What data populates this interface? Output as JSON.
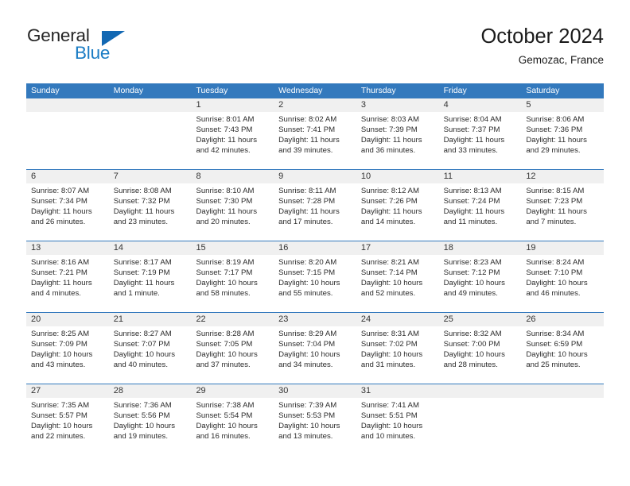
{
  "brand": {
    "name_part1": "General",
    "name_part2": "Blue",
    "triangle_color": "#1268B3",
    "blue_color": "#1A7CC4"
  },
  "header": {
    "title": "October 2024",
    "subtitle": "Gemozac, France"
  },
  "theme": {
    "header_blue": "#3379BD",
    "date_band_gray": "#F0F0F0",
    "text_color": "#2b2b2b"
  },
  "calendar": {
    "day_names": [
      "Sunday",
      "Monday",
      "Tuesday",
      "Wednesday",
      "Thursday",
      "Friday",
      "Saturday"
    ],
    "weeks": [
      [
        {
          "date": "",
          "lines": []
        },
        {
          "date": "",
          "lines": []
        },
        {
          "date": "1",
          "lines": [
            "Sunrise: 8:01 AM",
            "Sunset: 7:43 PM",
            "Daylight: 11 hours",
            "and 42 minutes."
          ]
        },
        {
          "date": "2",
          "lines": [
            "Sunrise: 8:02 AM",
            "Sunset: 7:41 PM",
            "Daylight: 11 hours",
            "and 39 minutes."
          ]
        },
        {
          "date": "3",
          "lines": [
            "Sunrise: 8:03 AM",
            "Sunset: 7:39 PM",
            "Daylight: 11 hours",
            "and 36 minutes."
          ]
        },
        {
          "date": "4",
          "lines": [
            "Sunrise: 8:04 AM",
            "Sunset: 7:37 PM",
            "Daylight: 11 hours",
            "and 33 minutes."
          ]
        },
        {
          "date": "5",
          "lines": [
            "Sunrise: 8:06 AM",
            "Sunset: 7:36 PM",
            "Daylight: 11 hours",
            "and 29 minutes."
          ]
        }
      ],
      [
        {
          "date": "6",
          "lines": [
            "Sunrise: 8:07 AM",
            "Sunset: 7:34 PM",
            "Daylight: 11 hours",
            "and 26 minutes."
          ]
        },
        {
          "date": "7",
          "lines": [
            "Sunrise: 8:08 AM",
            "Sunset: 7:32 PM",
            "Daylight: 11 hours",
            "and 23 minutes."
          ]
        },
        {
          "date": "8",
          "lines": [
            "Sunrise: 8:10 AM",
            "Sunset: 7:30 PM",
            "Daylight: 11 hours",
            "and 20 minutes."
          ]
        },
        {
          "date": "9",
          "lines": [
            "Sunrise: 8:11 AM",
            "Sunset: 7:28 PM",
            "Daylight: 11 hours",
            "and 17 minutes."
          ]
        },
        {
          "date": "10",
          "lines": [
            "Sunrise: 8:12 AM",
            "Sunset: 7:26 PM",
            "Daylight: 11 hours",
            "and 14 minutes."
          ]
        },
        {
          "date": "11",
          "lines": [
            "Sunrise: 8:13 AM",
            "Sunset: 7:24 PM",
            "Daylight: 11 hours",
            "and 11 minutes."
          ]
        },
        {
          "date": "12",
          "lines": [
            "Sunrise: 8:15 AM",
            "Sunset: 7:23 PM",
            "Daylight: 11 hours",
            "and 7 minutes."
          ]
        }
      ],
      [
        {
          "date": "13",
          "lines": [
            "Sunrise: 8:16 AM",
            "Sunset: 7:21 PM",
            "Daylight: 11 hours",
            "and 4 minutes."
          ]
        },
        {
          "date": "14",
          "lines": [
            "Sunrise: 8:17 AM",
            "Sunset: 7:19 PM",
            "Daylight: 11 hours",
            "and 1 minute."
          ]
        },
        {
          "date": "15",
          "lines": [
            "Sunrise: 8:19 AM",
            "Sunset: 7:17 PM",
            "Daylight: 10 hours",
            "and 58 minutes."
          ]
        },
        {
          "date": "16",
          "lines": [
            "Sunrise: 8:20 AM",
            "Sunset: 7:15 PM",
            "Daylight: 10 hours",
            "and 55 minutes."
          ]
        },
        {
          "date": "17",
          "lines": [
            "Sunrise: 8:21 AM",
            "Sunset: 7:14 PM",
            "Daylight: 10 hours",
            "and 52 minutes."
          ]
        },
        {
          "date": "18",
          "lines": [
            "Sunrise: 8:23 AM",
            "Sunset: 7:12 PM",
            "Daylight: 10 hours",
            "and 49 minutes."
          ]
        },
        {
          "date": "19",
          "lines": [
            "Sunrise: 8:24 AM",
            "Sunset: 7:10 PM",
            "Daylight: 10 hours",
            "and 46 minutes."
          ]
        }
      ],
      [
        {
          "date": "20",
          "lines": [
            "Sunrise: 8:25 AM",
            "Sunset: 7:09 PM",
            "Daylight: 10 hours",
            "and 43 minutes."
          ]
        },
        {
          "date": "21",
          "lines": [
            "Sunrise: 8:27 AM",
            "Sunset: 7:07 PM",
            "Daylight: 10 hours",
            "and 40 minutes."
          ]
        },
        {
          "date": "22",
          "lines": [
            "Sunrise: 8:28 AM",
            "Sunset: 7:05 PM",
            "Daylight: 10 hours",
            "and 37 minutes."
          ]
        },
        {
          "date": "23",
          "lines": [
            "Sunrise: 8:29 AM",
            "Sunset: 7:04 PM",
            "Daylight: 10 hours",
            "and 34 minutes."
          ]
        },
        {
          "date": "24",
          "lines": [
            "Sunrise: 8:31 AM",
            "Sunset: 7:02 PM",
            "Daylight: 10 hours",
            "and 31 minutes."
          ]
        },
        {
          "date": "25",
          "lines": [
            "Sunrise: 8:32 AM",
            "Sunset: 7:00 PM",
            "Daylight: 10 hours",
            "and 28 minutes."
          ]
        },
        {
          "date": "26",
          "lines": [
            "Sunrise: 8:34 AM",
            "Sunset: 6:59 PM",
            "Daylight: 10 hours",
            "and 25 minutes."
          ]
        }
      ],
      [
        {
          "date": "27",
          "lines": [
            "Sunrise: 7:35 AM",
            "Sunset: 5:57 PM",
            "Daylight: 10 hours",
            "and 22 minutes."
          ]
        },
        {
          "date": "28",
          "lines": [
            "Sunrise: 7:36 AM",
            "Sunset: 5:56 PM",
            "Daylight: 10 hours",
            "and 19 minutes."
          ]
        },
        {
          "date": "29",
          "lines": [
            "Sunrise: 7:38 AM",
            "Sunset: 5:54 PM",
            "Daylight: 10 hours",
            "and 16 minutes."
          ]
        },
        {
          "date": "30",
          "lines": [
            "Sunrise: 7:39 AM",
            "Sunset: 5:53 PM",
            "Daylight: 10 hours",
            "and 13 minutes."
          ]
        },
        {
          "date": "31",
          "lines": [
            "Sunrise: 7:41 AM",
            "Sunset: 5:51 PM",
            "Daylight: 10 hours",
            "and 10 minutes."
          ]
        },
        {
          "date": "",
          "lines": []
        },
        {
          "date": "",
          "lines": []
        }
      ]
    ]
  }
}
